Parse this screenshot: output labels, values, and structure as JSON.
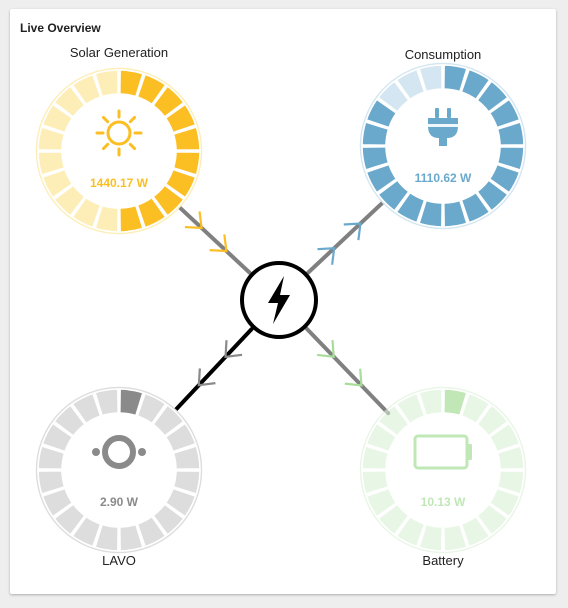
{
  "card": {
    "title": "Live Overview"
  },
  "gauges": [
    {
      "id": "solar",
      "name": "Solar Generation",
      "value_text": "1440.17 W",
      "icon": "sun-icon",
      "color": "#fbbf24",
      "light_color": "#fdeeb8",
      "fill_fraction": 0.5,
      "fill_direction": "clockwise",
      "opacity": 1
    },
    {
      "id": "consumption",
      "name": "Consumption",
      "value_text": "1110.62 W",
      "icon": "plug-icon",
      "color": "#6aa9cc",
      "light_color": "#d4e6f1",
      "fill_fraction": 0.85,
      "fill_direction": "clockwise",
      "opacity": 1
    },
    {
      "id": "lavo",
      "name": "LAVO",
      "value_text": "2.90 W",
      "icon": "ring-icon",
      "color": "#8a8a8a",
      "light_color": "#dddddd",
      "fill_fraction": 0.05,
      "fill_direction": "clockwise",
      "opacity": 1
    },
    {
      "id": "battery",
      "name": "Battery",
      "value_text": "10.13 W",
      "icon": "battery-icon",
      "color": "#8fd47e",
      "light_color": "#d7efd0",
      "fill_fraction": 0.05,
      "fill_direction": "clockwise",
      "opacity": 0.55
    }
  ],
  "hub": {
    "icon": "lightning-bolt-icon"
  },
  "flows": [
    {
      "from": "solar",
      "to": "hub",
      "color": "#fbbf24",
      "line": "#808080"
    },
    {
      "from": "hub",
      "to": "consumption",
      "color": "#6aa9cc",
      "line": "#808080"
    },
    {
      "from": "hub",
      "to": "lavo",
      "color": "#8a8a8a",
      "line": "#000000"
    },
    {
      "from": "hub",
      "to": "battery",
      "color": "#a8dc99",
      "line": "#808080"
    }
  ]
}
